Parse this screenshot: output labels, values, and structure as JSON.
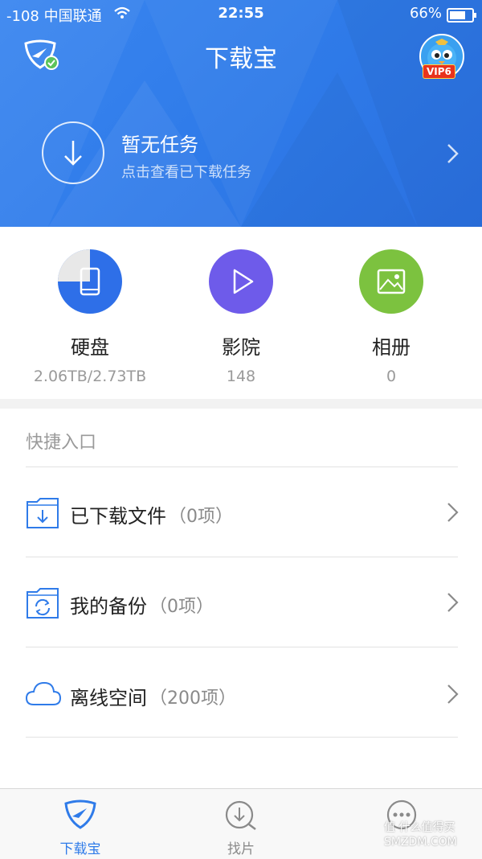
{
  "status": {
    "carrier": "-108 中国联通",
    "time": "22:55",
    "battery": "66%"
  },
  "header": {
    "title": "下载宝",
    "vip_badge": "VIP6"
  },
  "task": {
    "title": "暂无任务",
    "subtitle": "点击查看已下载任务"
  },
  "categories": [
    {
      "name": "硬盘",
      "value": "2.06TB/2.73TB",
      "usage_fraction": 0.754,
      "color": "#2e6fe8"
    },
    {
      "name": "影院",
      "value": "148",
      "color": "#6e5bea"
    },
    {
      "name": "相册",
      "value": "0",
      "color": "#7cc23f"
    }
  ],
  "quick": {
    "label": "快捷入口",
    "items": [
      {
        "label": "已下载文件",
        "count": "（0项）",
        "icon": "folder-download-icon"
      },
      {
        "label": "我的备份",
        "count": "（0项）",
        "icon": "folder-sync-icon"
      },
      {
        "label": "离线空间",
        "count": "（200项）",
        "icon": "cloud-icon"
      }
    ]
  },
  "tabs": [
    {
      "label": "下载宝",
      "active": true
    },
    {
      "label": "找片",
      "active": false
    },
    {
      "label": "",
      "active": false
    }
  ],
  "watermark": "值 什么值得买\nSMZDM.COM",
  "colors": {
    "accent": "#2f7be9",
    "active_tab": "#2f7be9",
    "inactive_tab": "#8a8a8a"
  }
}
